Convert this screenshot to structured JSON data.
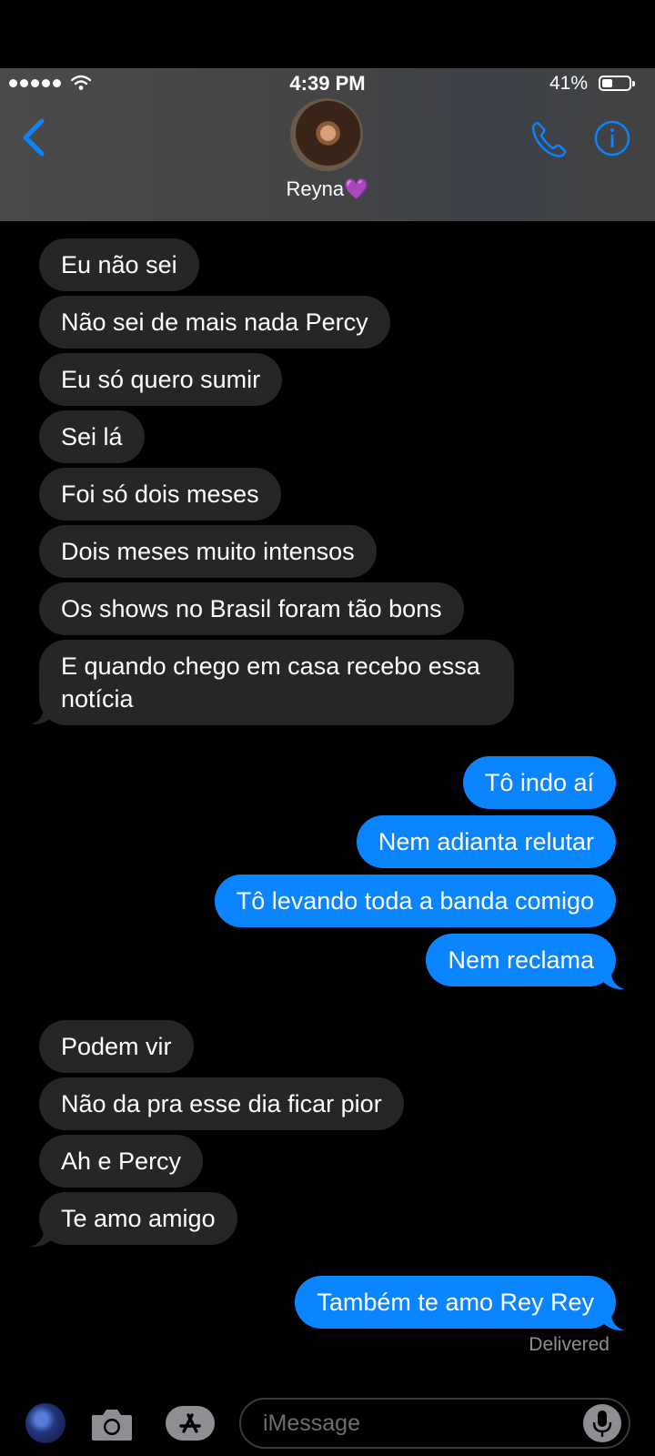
{
  "status_bar": {
    "time": "4:39 PM",
    "battery_percent_label": "41%",
    "battery_level": 0.41,
    "signal_icon": "cellular-signal-icon",
    "wifi_icon": "wifi-icon"
  },
  "header": {
    "contact_name": "Reyna💜",
    "back_icon": "chevron-left-icon",
    "call_icon": "phone-icon",
    "info_icon": "info-icon"
  },
  "messages": [
    {
      "from": "them",
      "text": "Eu não sei"
    },
    {
      "from": "them",
      "text": "Não sei de mais nada Percy"
    },
    {
      "from": "them",
      "text": "Eu só quero sumir"
    },
    {
      "from": "them",
      "text": "Sei lá"
    },
    {
      "from": "them",
      "text": "Foi só dois meses"
    },
    {
      "from": "them",
      "text": "Dois meses muito intensos"
    },
    {
      "from": "them",
      "text": "Os shows no Brasil foram tão bons"
    },
    {
      "from": "them",
      "text_line1": "E quando chego em casa recebo essa",
      "text_line2": "notícia"
    },
    {
      "from": "me",
      "text": "Tô indo aí"
    },
    {
      "from": "me",
      "text": "Nem adianta relutar"
    },
    {
      "from": "me",
      "text": "Tô levando toda a banda comigo"
    },
    {
      "from": "me",
      "text": "Nem reclama"
    },
    {
      "from": "them",
      "text": "Podem vir"
    },
    {
      "from": "them",
      "text": "Não da pra esse dia ficar pior"
    },
    {
      "from": "them",
      "text": "Ah e Percy"
    },
    {
      "from": "them",
      "text": "Te amo amigo"
    },
    {
      "from": "me",
      "text": "Também te amo Rey Rey"
    }
  ],
  "delivery_status": "Delivered",
  "composer": {
    "placeholder": "iMessage",
    "camera_icon": "camera-icon",
    "app_store_icon": "app-store-icon",
    "mic_icon": "microphone-icon"
  },
  "colors": {
    "incoming_bubble": "#262629",
    "outgoing_bubble": "#0a84ff",
    "accent": "#0a84ff",
    "background": "#000000",
    "secondary_text": "#8e8e93"
  }
}
